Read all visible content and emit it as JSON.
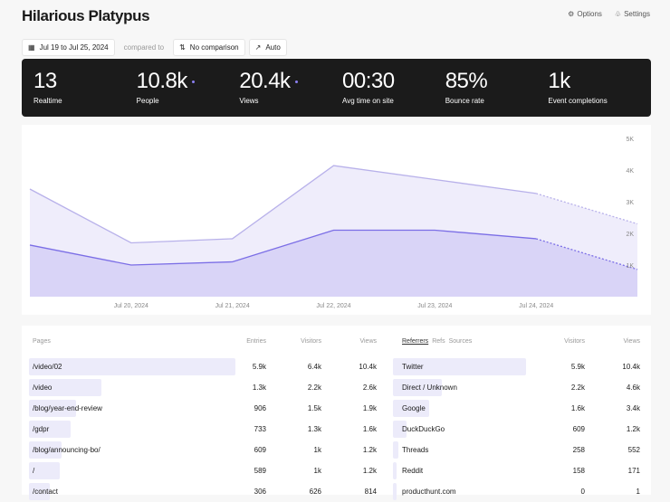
{
  "header": {
    "title": "Hilarious Platypus",
    "options": "Options",
    "settings": "Settings"
  },
  "controls": {
    "date_range": "Jul 19 to Jul 25, 2024",
    "compared_to": "compared to",
    "comparison": "No comparison",
    "interval": "Auto"
  },
  "stats": [
    {
      "value": "13",
      "label": "Realtime"
    },
    {
      "value": "10.8k",
      "label": "People",
      "dot": true
    },
    {
      "value": "20.4k",
      "label": "Views",
      "dot": true
    },
    {
      "value": "00:30",
      "label": "Avg time on site"
    },
    {
      "value": "85%",
      "label": "Bounce rate"
    },
    {
      "value": "1k",
      "label": "Event completions"
    }
  ],
  "colors": {
    "accent": "#7b6ee6",
    "views_fill": "#efedfb",
    "people_fill": "#d9d4f7"
  },
  "chart_data": {
    "type": "area",
    "x": [
      "Jul 19, 2024",
      "Jul 20, 2024",
      "Jul 21, 2024",
      "Jul 22, 2024",
      "Jul 23, 2024",
      "Jul 24, 2024",
      "Jul 25, 2024"
    ],
    "xtick_labels": [
      "Jul 20, 2024",
      "Jul 21, 2024",
      "Jul 22, 2024",
      "Jul 23, 2024",
      "Jul 24, 2024"
    ],
    "ytick_labels": [
      "1K",
      "2K",
      "3K",
      "4K",
      "5K"
    ],
    "ylim": [
      0,
      5000
    ],
    "series": [
      {
        "key": "views",
        "values": [
          3400,
          1700,
          1830,
          4140,
          3700,
          3260,
          2300
        ]
      },
      {
        "key": "people",
        "values": [
          1630,
          1000,
          1100,
          2100,
          2100,
          1830,
          860
        ]
      }
    ],
    "last_segment_dashed": true
  },
  "pages": {
    "headers": [
      "Pages",
      "Entries",
      "Visitors",
      "Views"
    ],
    "rows": [
      {
        "name": "/video/02",
        "entries": "5.9k",
        "visitors": "6.4k",
        "views": "10.4k",
        "share": 1
      },
      {
        "name": "/video",
        "entries": "1.3k",
        "visitors": "2.2k",
        "views": "2.6k",
        "share": 0.35
      },
      {
        "name": "/blog/year-end-review",
        "entries": "906",
        "visitors": "1.5k",
        "views": "1.9k",
        "share": 0.23
      },
      {
        "name": "/gdpr",
        "entries": "733",
        "visitors": "1.3k",
        "views": "1.6k",
        "share": 0.2
      },
      {
        "name": "/blog/announcing-bo/",
        "entries": "609",
        "visitors": "1k",
        "views": "1.2k",
        "share": 0.16
      },
      {
        "name": "/",
        "entries": "589",
        "visitors": "1k",
        "views": "1.2k",
        "share": 0.15
      },
      {
        "name": "/contact",
        "entries": "306",
        "visitors": "626",
        "views": "814",
        "share": 0.1
      }
    ]
  },
  "referrers": {
    "tabs": [
      "Referrers",
      "Refs",
      "Sources"
    ],
    "headers": [
      "Visitors",
      "Views"
    ],
    "rows": [
      {
        "name": "Twitter",
        "visitors": "5.9k",
        "views": "10.4k",
        "share": 1
      },
      {
        "name": "Direct / Unknown",
        "visitors": "2.2k",
        "views": "4.6k",
        "share": 0.37
      },
      {
        "name": "Google",
        "visitors": "1.6k",
        "views": "3.4k",
        "share": 0.27
      },
      {
        "name": "DuckDuckGo",
        "visitors": "609",
        "views": "1.2k",
        "share": 0.1
      },
      {
        "name": "Threads",
        "visitors": "258",
        "views": "552",
        "share": 0.04
      },
      {
        "name": "Reddit",
        "visitors": "158",
        "views": "171",
        "share": 0.03
      },
      {
        "name": "producthunt.com",
        "visitors": "0",
        "views": "1",
        "share": 0
      }
    ]
  }
}
